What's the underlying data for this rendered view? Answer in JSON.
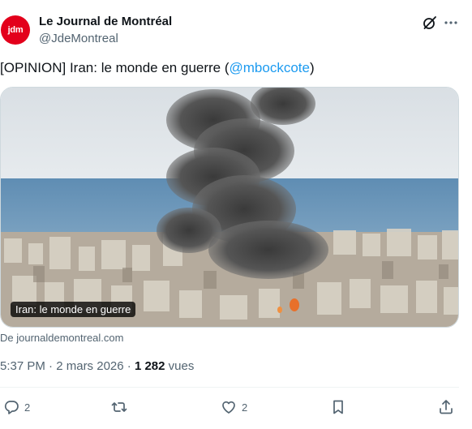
{
  "account": {
    "avatar_text": "jdm",
    "display_name": "Le Journal de Montréal",
    "handle": "@JdeMontreal"
  },
  "tweet": {
    "text_prefix": "[OPINION] Iran: le monde en guerre (",
    "mention": "@mbockcote",
    "text_suffix": ")"
  },
  "card": {
    "caption": "Iran: le monde en guerre",
    "source": "De journaldemontreal.com"
  },
  "meta": {
    "time": "5:37 PM",
    "separator1": " · ",
    "date": "2 mars 2026",
    "separator2": " · ",
    "views_count": "1 282",
    "views_label": " vues"
  },
  "actions": {
    "replies": "2",
    "likes": "2"
  },
  "icons": {
    "grok": "grok-icon",
    "more": "more-icon",
    "reply": "reply-icon",
    "retweet": "retweet-icon",
    "like": "heart-icon",
    "bookmark": "bookmark-icon",
    "share": "share-icon"
  },
  "colors": {
    "brand_red": "#e3001b",
    "link_blue": "#1d9bf0",
    "secondary_text": "#536471"
  }
}
